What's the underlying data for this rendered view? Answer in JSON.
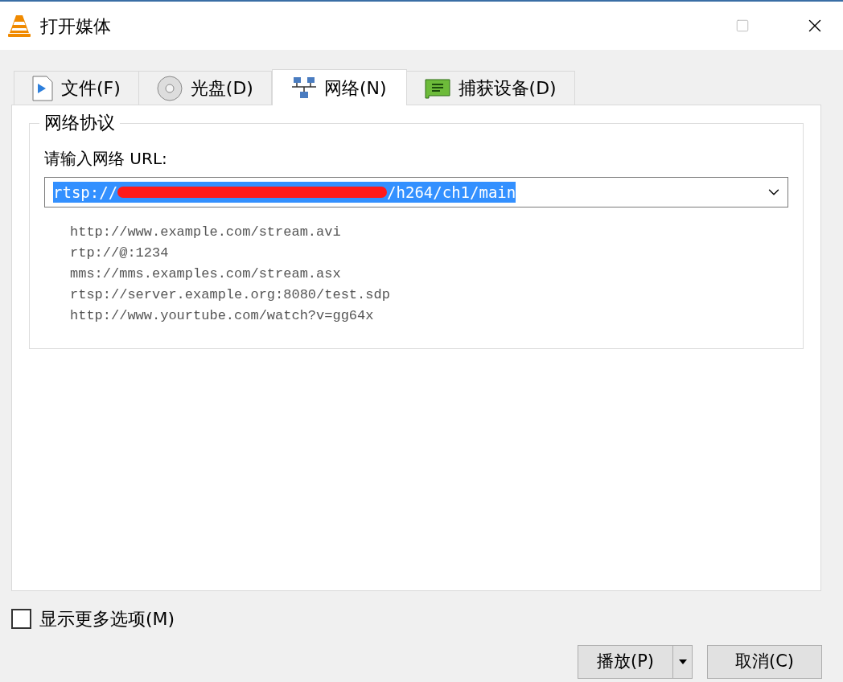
{
  "window": {
    "title": "打开媒体"
  },
  "tabs": [
    {
      "label": "文件(F)",
      "kind": "file",
      "selected": false
    },
    {
      "label": "光盘(D)",
      "kind": "disc",
      "selected": false
    },
    {
      "label": "网络(N)",
      "kind": "network",
      "selected": true
    },
    {
      "label": "捕获设备(D)",
      "kind": "capture",
      "selected": false
    }
  ],
  "group": {
    "title": "网络协议",
    "url_label": "请输入网络 URL:",
    "url": {
      "before": "rtsp://",
      "redacted": true,
      "after": "/h264/ch1/main",
      "selected": true
    },
    "examples": [
      "http://www.example.com/stream.avi",
      "rtp://@:1234",
      "mms://mms.examples.com/stream.asx",
      "rtsp://server.example.org:8080/test.sdp",
      "http://www.yourtube.com/watch?v=gg64x"
    ]
  },
  "more_options": {
    "label": "显示更多选项(M)",
    "checked": false
  },
  "buttons": [
    {
      "label": "播放(P)",
      "split": true
    },
    {
      "label": "取消(C)",
      "split": false
    }
  ]
}
